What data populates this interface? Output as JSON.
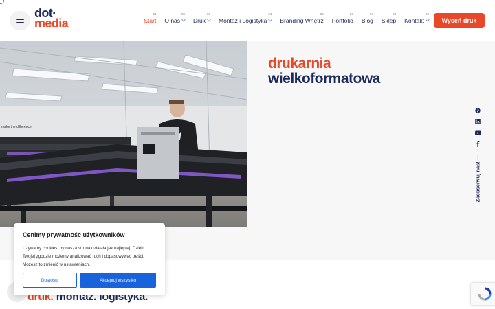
{
  "brand": {
    "logo_line1": "dot·",
    "logo_line2": "media"
  },
  "nav": {
    "items": [
      {
        "num": "01",
        "label": "Start",
        "active": true,
        "dropdown": false
      },
      {
        "num": "02",
        "label": "O nas",
        "dropdown": true
      },
      {
        "num": "03",
        "label": "Druk",
        "dropdown": true
      },
      {
        "num": "04",
        "label": "Montaż i Logistyka",
        "dropdown": true
      },
      {
        "num": "05",
        "label": "Branding Wnętrz",
        "dropdown": false
      },
      {
        "num": "06",
        "label": "Portfolio",
        "dropdown": false
      },
      {
        "num": "07",
        "label": "Blog",
        "dropdown": false
      },
      {
        "num": "08",
        "label": "Sklep",
        "dropdown": false
      },
      {
        "num": "09",
        "label": "Kontakt",
        "dropdown": true
      }
    ],
    "cta_label": "Wyceń druk"
  },
  "hero": {
    "title_line1": "drukarnia",
    "title_line2": "wielkoformatowa",
    "photo_wall_text": "make the difference."
  },
  "social": {
    "icons": [
      "pinterest-icon",
      "linkedin-icon",
      "youtube-icon",
      "facebook-icon"
    ],
    "label": "Zaobserwuj nas! —"
  },
  "tagline": {
    "part1": "druk.",
    "part2": "montaż. logistyka."
  },
  "cookie": {
    "title": "Cenimy prywatność użytkowników",
    "body": "Używamy cookies, by nasza strona działała jak najlepiej. Dzięki Twojej zgodzie możemy analizować ruch i dopasowywać treści. Możesz to zmienić w ustawieniach.",
    "customize_label": "Dostosuj",
    "accept_label": "Akceptuj wszystko"
  },
  "colors": {
    "accent": "#e94727",
    "navy": "#1d2a5c",
    "cookie_blue": "#1863dc"
  }
}
